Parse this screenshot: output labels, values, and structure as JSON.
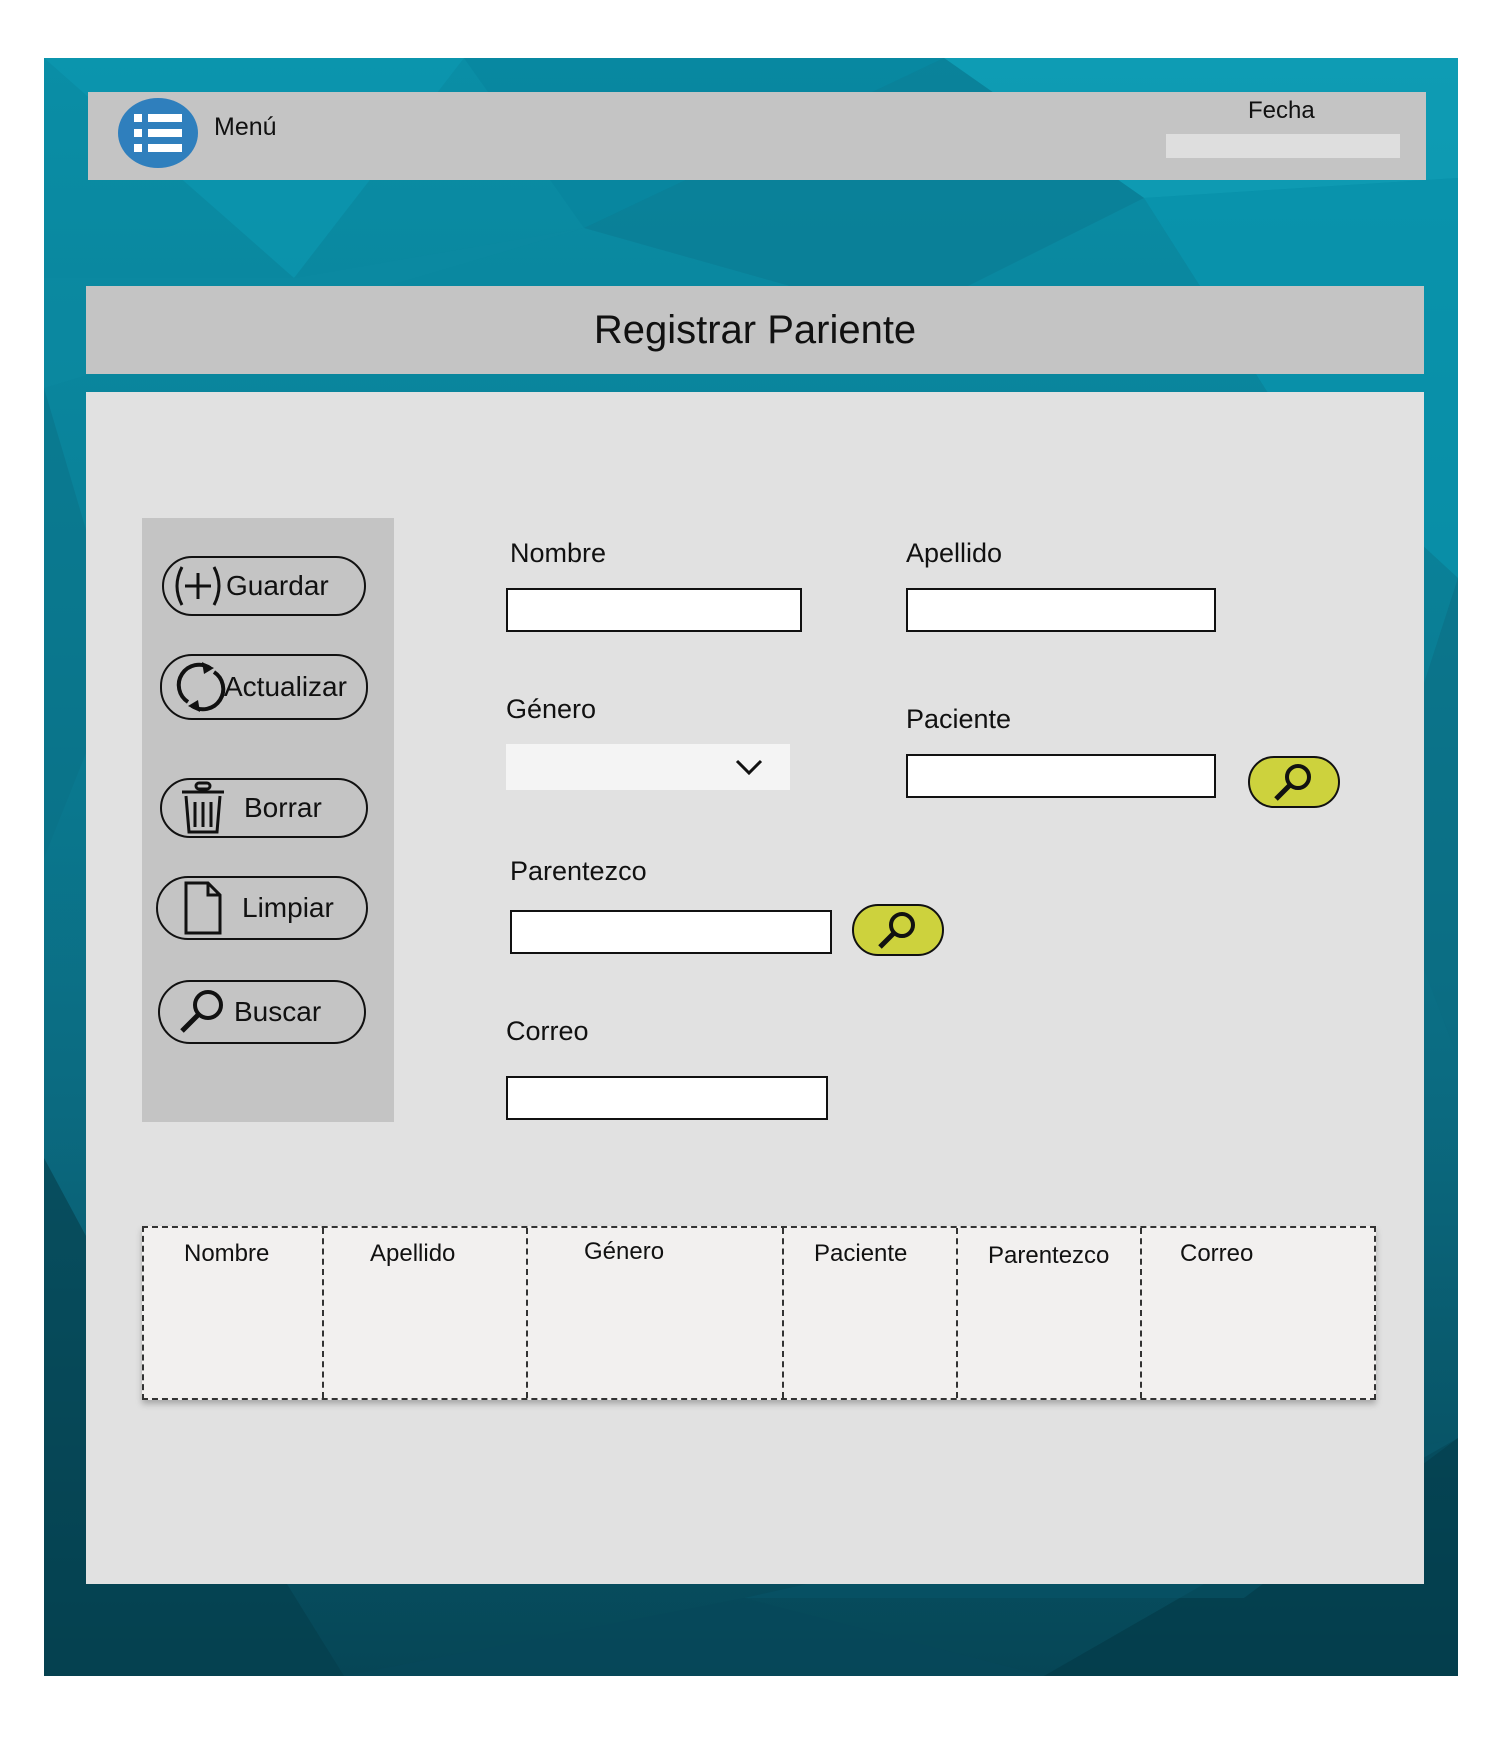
{
  "header": {
    "menu_label": "Menú",
    "menu_icon": "list-menu-icon",
    "fecha_label": "Fecha",
    "fecha_value": ""
  },
  "page_title": "Registrar Pariente",
  "actions": {
    "guardar": "Guardar",
    "actualizar": "Actualizar",
    "borrar": "Borrar",
    "limpiar": "Limpiar",
    "buscar": "Buscar"
  },
  "form": {
    "nombre_label": "Nombre",
    "nombre_value": "",
    "apellido_label": "Apellido",
    "apellido_value": "",
    "genero_label": "Género",
    "genero_value": "",
    "paciente_label": "Paciente",
    "paciente_value": "",
    "parentezco_label": "Parentezco",
    "parentezco_value": "",
    "correo_label": "Correo",
    "correo_value": ""
  },
  "table": {
    "columns": [
      "Nombre",
      "Apellido",
      "Género",
      "Paciente",
      "Parentezco",
      "Correo"
    ],
    "rows": []
  },
  "colors": {
    "background_teal": "#0a8ea6",
    "panel_gray": "#c4c4c4",
    "content_gray": "#e1e1e1",
    "search_button": "#cdd23d",
    "menu_icon_blue": "#2f7fbd"
  }
}
